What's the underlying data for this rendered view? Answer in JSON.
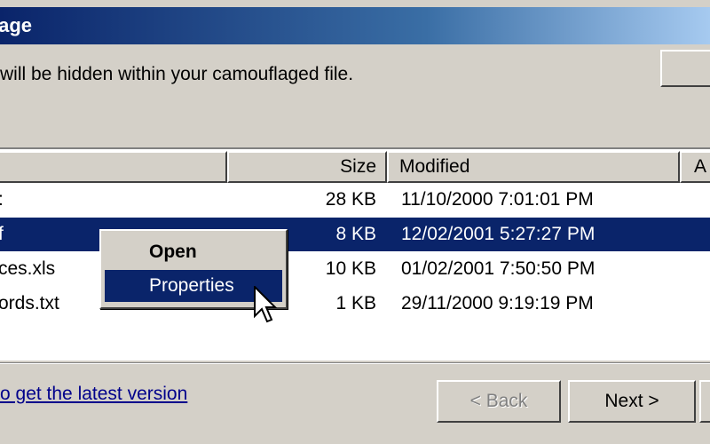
{
  "window": {
    "title": "lage"
  },
  "description": "will be hidden within your camouflaged file.",
  "list": {
    "columns": [
      "",
      "Size",
      "Modified",
      "A"
    ],
    "rows": [
      {
        "name": ":",
        "size": "28 KB",
        "modified": "11/10/2000 7:01:01 PM",
        "selected": false
      },
      {
        "name": "f",
        "size": "8 KB",
        "modified": "12/02/2001 5:27:27 PM",
        "selected": true
      },
      {
        "name": "ces.xls",
        "size": "10 KB",
        "modified": "01/02/2001 7:50:50 PM",
        "selected": false
      },
      {
        "name": "ords.txt",
        "size": "1 KB",
        "modified": "29/11/2000 9:19:19 PM",
        "selected": false
      }
    ]
  },
  "context_menu": {
    "open_label": "Open",
    "properties_label": "Properties"
  },
  "footer": {
    "link_text": "o get the latest version",
    "back_label": "< Back",
    "next_label": "Next >"
  },
  "colors": {
    "selection": "#0a246a",
    "face": "#d4d0c8"
  }
}
